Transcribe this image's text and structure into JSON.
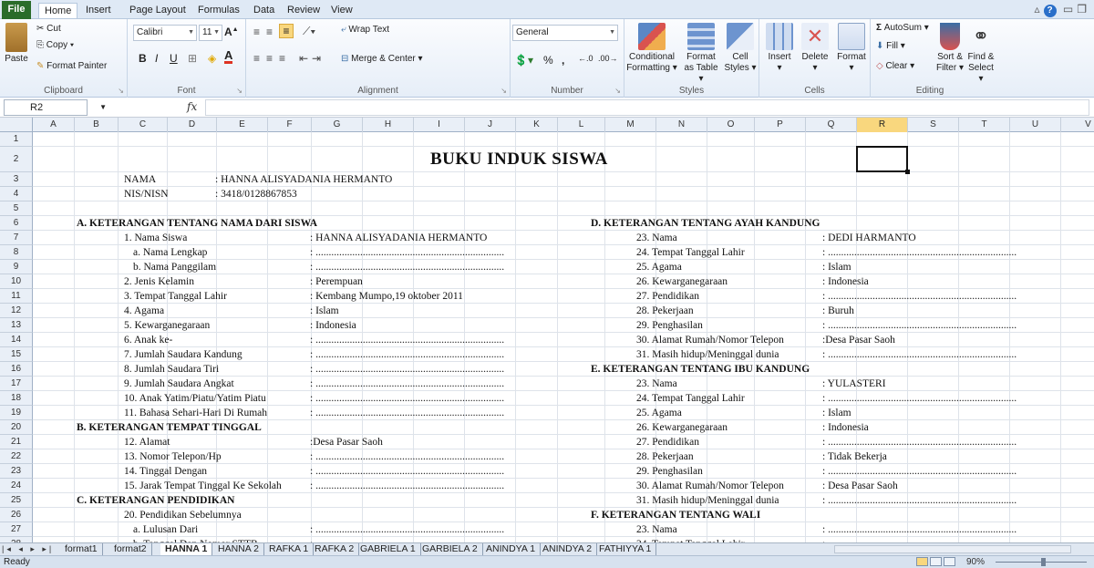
{
  "ribbon_tabs": [
    "File",
    "Home",
    "Insert",
    "Page Layout",
    "Formulas",
    "Data",
    "Review",
    "View"
  ],
  "clipboard": {
    "paste": "Paste",
    "cut": "Cut",
    "copy": "Copy",
    "format_painter": "Format Painter",
    "label": "Clipboard"
  },
  "font": {
    "name": "Calibri",
    "size": "11",
    "bold": "B",
    "italic": "I",
    "underline": "U",
    "label": "Font"
  },
  "alignment": {
    "wrap_text": "Wrap Text",
    "merge_center": "Merge & Center",
    "label": "Alignment"
  },
  "number": {
    "format": "General",
    "percent": "%",
    "comma": ",",
    "label": "Number"
  },
  "styles": {
    "conditional": "Conditional",
    "formatting": "Formatting",
    "format_as": "Format",
    "as_table": "as Table",
    "cell": "Cell",
    "cell_styles": "Styles",
    "label": "Styles"
  },
  "cells": {
    "insert": "Insert",
    "delete": "Delete",
    "format": "Format",
    "label": "Cells"
  },
  "editing": {
    "autosum": "AutoSum",
    "fill": "Fill",
    "clear": "Clear",
    "sort_filter_1": "Sort &",
    "sort_filter_2": "Filter",
    "find_select_1": "Find &",
    "find_select_2": "Select",
    "label": "Editing"
  },
  "formula_bar": {
    "name_box": "R2",
    "fx": "fx",
    "formula": ""
  },
  "columns": [
    "A",
    "B",
    "C",
    "D",
    "E",
    "F",
    "G",
    "H",
    "I",
    "J",
    "K",
    "L",
    "M",
    "N",
    "O",
    "P",
    "Q",
    "R",
    "S",
    "T",
    "U",
    "V",
    "W"
  ],
  "selected_column": "R",
  "rows": [
    "1",
    "2",
    "3",
    "4",
    "5",
    "6",
    "7",
    "8",
    "9",
    "10",
    "11",
    "12",
    "13",
    "14",
    "15",
    "16",
    "17",
    "18",
    "19",
    "20",
    "21",
    "22",
    "23",
    "24",
    "25",
    "26",
    "27",
    "28"
  ],
  "sheet": {
    "title": "BUKU INDUK SISWA",
    "nama_label": "NAMA",
    "nama_value": ": HANNA ALISYADANIA HERMANTO",
    "nis_label": "NIS/NISN",
    "nis_value": ": 3418/0128867853",
    "blank": ": ........................................................................",
    "left": [
      {
        "text": "A. KETERANGAN TENTANG NAMA DARI SISWA",
        "bold": true,
        "indent": 0,
        "value": ""
      },
      {
        "text": "1. Nama Siswa",
        "bold": false,
        "indent": 1,
        "value": ": HANNA ALISYADANIA HERMANTO"
      },
      {
        "text": "a. Nama Lengkap",
        "bold": false,
        "indent": 2,
        "value": "blank"
      },
      {
        "text": "b. Nama Panggilam",
        "bold": false,
        "indent": 2,
        "value": "blank"
      },
      {
        "text": "2. Jenis Kelamin",
        "bold": false,
        "indent": 1,
        "value": ": Perempuan"
      },
      {
        "text": "3. Tempat Tanggal Lahir",
        "bold": false,
        "indent": 1,
        "value": ": Kembang Mumpo,19 oktober 2011"
      },
      {
        "text": "4. Agama",
        "bold": false,
        "indent": 1,
        "value": ": Islam"
      },
      {
        "text": "5. Kewarganegaraan",
        "bold": false,
        "indent": 1,
        "value": ": Indonesia"
      },
      {
        "text": "6. Anak ke-",
        "bold": false,
        "indent": 1,
        "value": "blank"
      },
      {
        "text": "7. Jumlah Saudara Kandung",
        "bold": false,
        "indent": 1,
        "value": "blank"
      },
      {
        "text": "8. Jumlah Saudara Tiri",
        "bold": false,
        "indent": 1,
        "value": "blank"
      },
      {
        "text": "9. Jumlah Saudara Angkat",
        "bold": false,
        "indent": 1,
        "value": "blank"
      },
      {
        "text": "10. Anak Yatim/Piatu/Yatim Piatu",
        "bold": false,
        "indent": 1,
        "value": "blank"
      },
      {
        "text": "11. Bahasa Sehari-Hari Di Rumah",
        "bold": false,
        "indent": 1,
        "value": "blank"
      },
      {
        "text": "B. KETERANGAN TEMPAT TINGGAL",
        "bold": true,
        "indent": 0,
        "value": ""
      },
      {
        "text": "12. Alamat",
        "bold": false,
        "indent": 1,
        "value": ":Desa Pasar Saoh"
      },
      {
        "text": "13. Nomor Telepon/Hp",
        "bold": false,
        "indent": 1,
        "value": "blank"
      },
      {
        "text": "14. Tinggal Dengan",
        "bold": false,
        "indent": 1,
        "value": "blank"
      },
      {
        "text": "15. Jarak Tempat Tinggal Ke Sekolah",
        "bold": false,
        "indent": 1,
        "value": "blank"
      },
      {
        "text": "C. KETERANGAN PENDIDIKAN",
        "bold": true,
        "indent": 0,
        "value": ""
      },
      {
        "text": "20. Pendidikan Sebelumnya",
        "bold": false,
        "indent": 1,
        "value": ""
      },
      {
        "text": "a. Lulusan Dari",
        "bold": false,
        "indent": 2,
        "value": "blank"
      },
      {
        "text": "b. Tanggal Dan Nomor STTB",
        "bold": false,
        "indent": 2,
        "value": "blank"
      }
    ],
    "right": [
      {
        "text": "D. KETERANGAN TENTANG AYAH KANDUNG",
        "bold": true,
        "indent": 0,
        "value": ""
      },
      {
        "text": "23. Nama",
        "bold": false,
        "indent": 1,
        "value": ": DEDI HARMANTO"
      },
      {
        "text": "24. Tempat Tanggal Lahir",
        "bold": false,
        "indent": 1,
        "value": "blank"
      },
      {
        "text": "25. Agama",
        "bold": false,
        "indent": 1,
        "value": ": Islam"
      },
      {
        "text": "26. Kewarganegaraan",
        "bold": false,
        "indent": 1,
        "value": ": Indonesia"
      },
      {
        "text": "27. Pendidikan",
        "bold": false,
        "indent": 1,
        "value": "blank"
      },
      {
        "text": "28. Pekerjaan",
        "bold": false,
        "indent": 1,
        "value": ": Buruh"
      },
      {
        "text": "29. Penghasilan",
        "bold": false,
        "indent": 1,
        "value": "blank"
      },
      {
        "text": "30. Alamat Rumah/Nomor Telepon",
        "bold": false,
        "indent": 1,
        "value": ":Desa Pasar Saoh"
      },
      {
        "text": "31. Masih hidup/Meninggal dunia",
        "bold": false,
        "indent": 1,
        "value": "blank"
      },
      {
        "text": "E. KETERANGAN TENTANG IBU KANDUNG",
        "bold": true,
        "indent": 0,
        "value": ""
      },
      {
        "text": "23. Nama",
        "bold": false,
        "indent": 1,
        "value": ": YULASTERI"
      },
      {
        "text": "24. Tempat Tanggal Lahir",
        "bold": false,
        "indent": 1,
        "value": "blank"
      },
      {
        "text": "25. Agama",
        "bold": false,
        "indent": 1,
        "value": ": Islam"
      },
      {
        "text": "26. Kewarganegaraan",
        "bold": false,
        "indent": 1,
        "value": ": Indonesia"
      },
      {
        "text": "27. Pendidikan",
        "bold": false,
        "indent": 1,
        "value": "blank"
      },
      {
        "text": "28. Pekerjaan",
        "bold": false,
        "indent": 1,
        "value": ": Tidak Bekerja"
      },
      {
        "text": "29. Penghasilan",
        "bold": false,
        "indent": 1,
        "value": "blank"
      },
      {
        "text": "30. Alamat Rumah/Nomor Telepon",
        "bold": false,
        "indent": 1,
        "value": ": Desa Pasar Saoh"
      },
      {
        "text": "31. Masih hidup/Meninggal dunia",
        "bold": false,
        "indent": 1,
        "value": "blank"
      },
      {
        "text": "F. KETERANGAN TENTANG WALI",
        "bold": true,
        "indent": 0,
        "value": ""
      },
      {
        "text": "23. Nama",
        "bold": false,
        "indent": 1,
        "value": "blank"
      },
      {
        "text": "24. Tempat Tanggal Lahir",
        "bold": false,
        "indent": 1,
        "value": "blank"
      }
    ]
  },
  "sheet_tabs": [
    "format1",
    "format2",
    "HANNA 1",
    "HANNA 2",
    "RAFKA 1",
    "RAFKA 2",
    "GABRIELA 1",
    "GARBIELA 2",
    "ANINDYA 1",
    "ANINDYA 2",
    "FATHIYYA 1"
  ],
  "active_sheet": "HANNA 1",
  "status": {
    "ready": "Ready",
    "zoom": "90%"
  },
  "colors": {
    "file_tab": "#2a6c2a",
    "selection_header": "#f9d77e",
    "ribbon_bg": "#dfe9f5"
  }
}
